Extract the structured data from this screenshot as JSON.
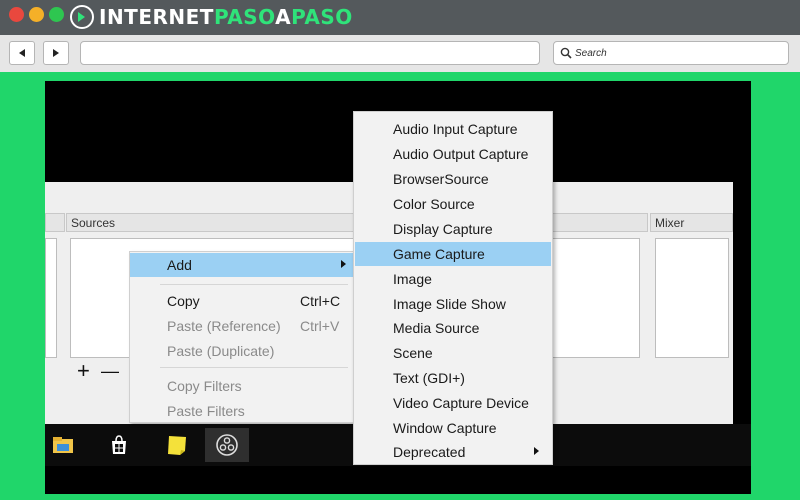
{
  "browser": {
    "logo_part1": "INTERNET",
    "logo_part2": "PASO",
    "logo_part3": "A",
    "logo_part4": "PASO",
    "search_label": "Search"
  },
  "obs": {
    "sources_label": "Sources",
    "mixer_label": "Mixer",
    "add_symbol": "+",
    "remove_symbol": "—"
  },
  "context_menu": {
    "add": "Add",
    "copy": "Copy",
    "copy_shortcut": "Ctrl+C",
    "paste_reference": "Paste (Reference)",
    "paste_reference_shortcut": "Ctrl+V",
    "paste_duplicate": "Paste (Duplicate)",
    "copy_filters": "Copy Filters",
    "paste_filters": "Paste Filters"
  },
  "submenu": {
    "items": [
      "Audio Input Capture",
      "Audio Output Capture",
      "BrowserSource",
      "Color Source",
      "Display Capture",
      "Game Capture",
      "Image",
      "Image Slide Show",
      "Media Source",
      "Scene",
      "Text (GDI+)",
      "Video Capture Device",
      "Window Capture",
      "Deprecated"
    ],
    "highlighted": "Game Capture"
  },
  "taskbar": {
    "icons": [
      "file-explorer-icon",
      "store-icon",
      "sticky-notes-icon",
      "obs-icon"
    ]
  },
  "colors": {
    "page_green": "#20d66a",
    "logo_green": "#2fe37a",
    "highlight": "#9bd0f3"
  }
}
